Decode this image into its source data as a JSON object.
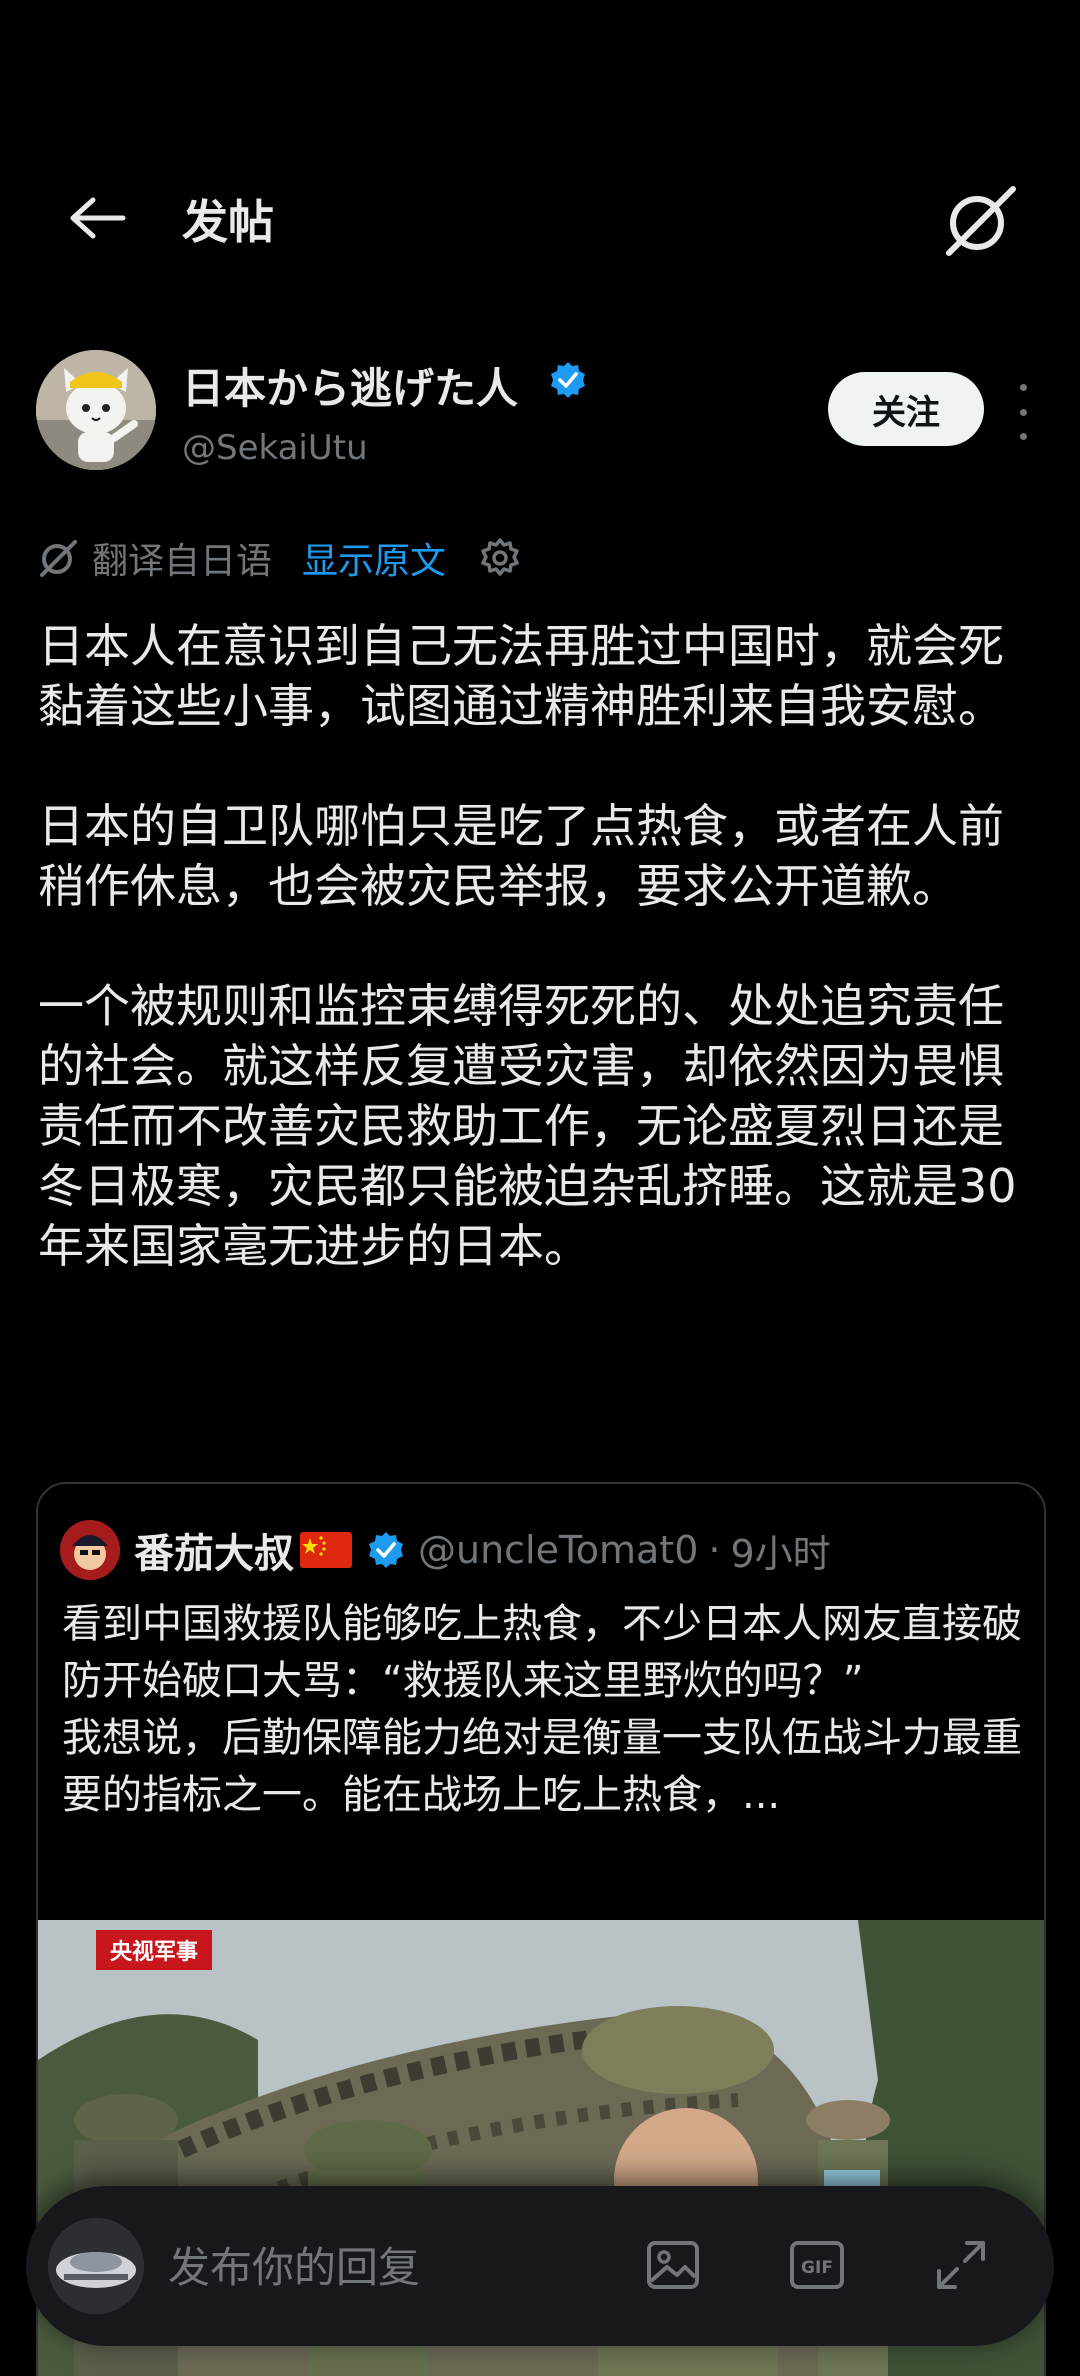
{
  "header": {
    "title": "发帖"
  },
  "author": {
    "name": "日本から逃げた人",
    "handle": "@SekaiUtu",
    "follow_label": "关注"
  },
  "translation": {
    "label": "翻译自日语",
    "show_original": "显示原文"
  },
  "tweet": {
    "paragraphs": [
      "日本人在意识到自己无法再胜过中国时，就会死黏着这些小事，试图通过精神胜利来自我安慰。",
      "日本的自卫队哪怕只是吃了点热食，或者在人前稍作休息，也会被灾民举报，要求公开道歉。",
      "一个被规则和监控束缚得死死的、处处追究责任的社会。就这样反复遭受灾害，却依然因为畏惧责任而不改善灾民救助工作，无论盛夏烈日还是冬日极寒，灾民都只能被迫杂乱挤睡。这就是30年来国家毫无进步的日本。"
    ]
  },
  "quote": {
    "name": "番茄大叔",
    "handle": "@uncleTomat0",
    "separator": "·",
    "time": "9小时",
    "lines": [
      "看到中国救援队能够吃上热食，不少日本人网友直接破防开始破口大骂：“救援队来这里野炊的吗？”",
      "我想说，后勤保障能力绝对是衡量一支队伍战斗力最重要的指标之一。能在战场上吃上热食，..."
    ],
    "image_tag": "央视军事"
  },
  "reply": {
    "placeholder": "发布你的回复",
    "gif_label": "GIF"
  },
  "colors": {
    "background": "#000000",
    "text": "#e7e9ea",
    "muted": "#71767b",
    "link": "#1d9bf0",
    "verified": "#1d9bf0",
    "border": "#2f3336"
  }
}
